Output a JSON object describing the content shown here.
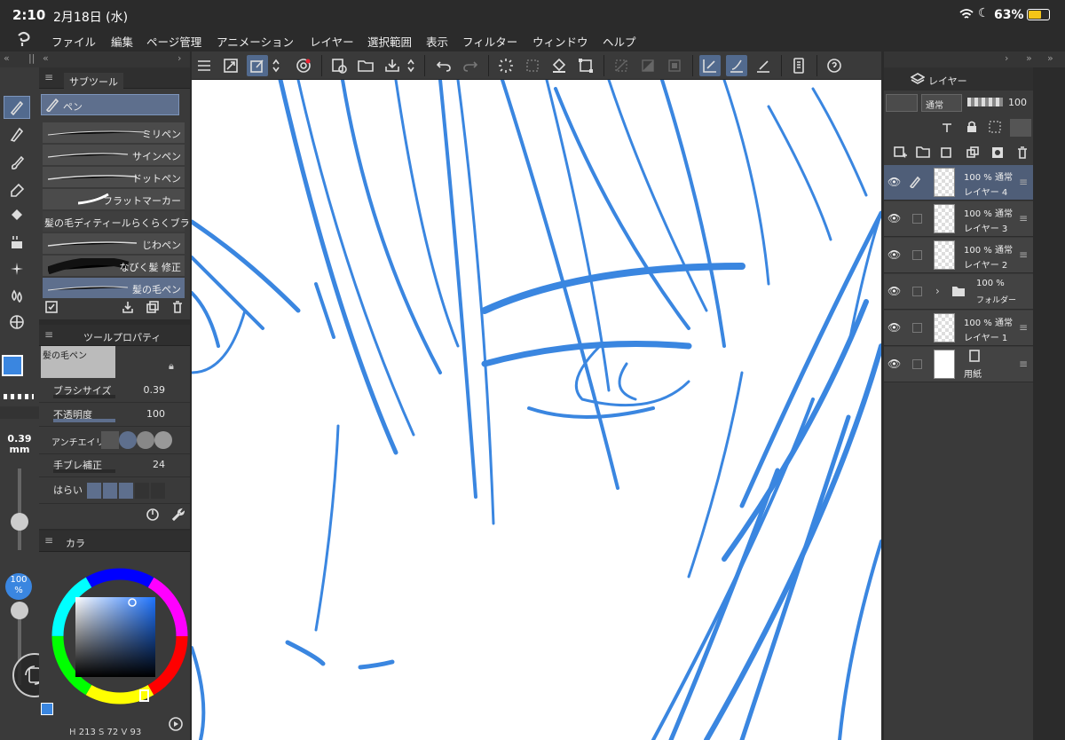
{
  "status": {
    "time": "2:10",
    "date": "2月18日 (水)",
    "battery": "63%"
  },
  "menu": [
    "ファイル",
    "編集",
    "ページ管理",
    "アニメーション",
    "レイヤー",
    "選択範囲",
    "表示",
    "フィルター",
    "ウィンドウ",
    "ヘルプ"
  ],
  "subtool": {
    "tab": "サブツール",
    "group": "ペン",
    "brushes": [
      "ミリペン",
      "サインペン",
      "ドットペン",
      "フラットマーカー",
      "髪の毛ディティールらくらくブラ",
      "じわペン",
      "なびく髪 修正",
      "髪の毛ペン"
    ]
  },
  "toolprop": {
    "tab": "ツールプロパティ",
    "tool": "髪の毛ペン",
    "brush_size_label": "ブラシサイズ",
    "brush_size": "0.39",
    "opacity_label": "不透明度",
    "opacity": "100",
    "aa_label": "アンチエイリ",
    "stabilize_label": "手ブレ補正",
    "stabilize": "24",
    "taper_label": "はらい"
  },
  "leftpanel": {
    "size_value": "0.39",
    "size_unit": "mm",
    "opacity_value": "100",
    "opacity_unit": "%"
  },
  "color": {
    "tab": "カラ",
    "h_label": "H",
    "h": "213",
    "s_label": "S",
    "s": "72",
    "v_label": "V",
    "v": "93",
    "main": "#3a86e0",
    "sub": "#ffffff"
  },
  "layers": {
    "tab": "レイヤー",
    "blend": "通常",
    "opacity": "100",
    "items": [
      {
        "op": "100 % 通常",
        "name": "レイヤー 4",
        "selected": true
      },
      {
        "op": "100 % 通常",
        "name": "レイヤー 3"
      },
      {
        "op": "100 % 通常",
        "name": "レイヤー 2"
      },
      {
        "op": "100 %",
        "name": "フォルダー"
      },
      {
        "op": "100 % 通常",
        "name": "レイヤー 1"
      },
      {
        "op": "",
        "name": "用紙"
      }
    ]
  },
  "accent": "#526a8e",
  "stroke_color": "#3a86e0"
}
